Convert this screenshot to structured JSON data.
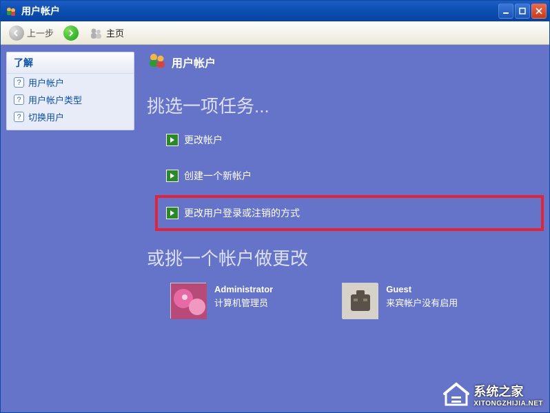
{
  "window": {
    "title": "用户帐户"
  },
  "toolbar": {
    "back_label": "上一步",
    "home_label": "主页"
  },
  "sidebar": {
    "header": "了解",
    "items": [
      {
        "label": "用户帐户"
      },
      {
        "label": "用户帐户类型"
      },
      {
        "label": "切换用户"
      }
    ]
  },
  "main": {
    "page_title": "用户帐户",
    "section1": "挑选一项任务...",
    "tasks": [
      {
        "label": "更改帐户"
      },
      {
        "label": "创建一个新帐户"
      },
      {
        "label": "更改用户登录或注销的方式"
      }
    ],
    "section2": "或挑一个帐户做更改",
    "accounts": [
      {
        "name": "Administrator",
        "desc": "计算机管理员"
      },
      {
        "name": "Guest",
        "desc": "来宾帐户没有启用"
      }
    ]
  },
  "watermark": {
    "title": "系统之家",
    "url": "XITONGZHIJIA.NET"
  }
}
